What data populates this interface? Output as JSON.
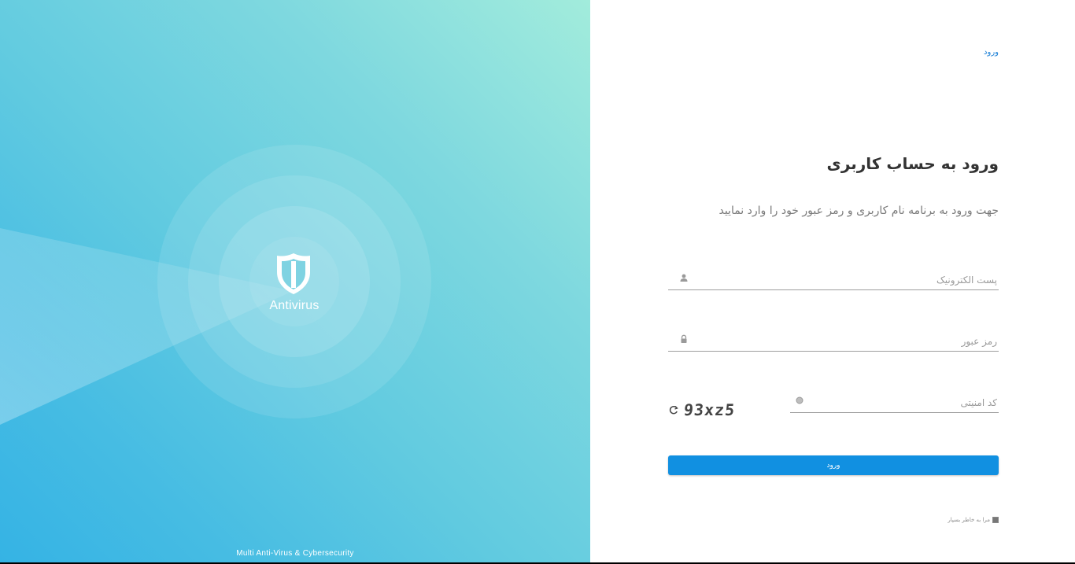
{
  "hero": {
    "logo_text": "Antivirus",
    "footer_text": "Multi Anti-Virus & Cybersecurity"
  },
  "panel": {
    "top_link": "ورود",
    "title": "ورود به حساب کاربری",
    "subtitle": "جهت ورود به برنامه نام کاربری و رمز عبور خود را وارد نمایید",
    "email_placeholder": "پست الکترونیک",
    "email_value": "",
    "password_placeholder": "رمز عبور",
    "password_value": "",
    "captcha_placeholder": "کد امنیتی",
    "captcha_value": "",
    "captcha_code": "93xz5",
    "login_label": "ورود",
    "remember_label": "مرا به خاطر بسپار",
    "remember_checked": true
  },
  "colors": {
    "accent": "#1190e1",
    "link": "#1a7fd6",
    "hero_light": "#a2ecdc",
    "hero_dark": "#35b3e4"
  },
  "icons": {
    "email": "user-icon",
    "password": "lock-icon",
    "captcha": "circle-icon",
    "refresh": "refresh-icon",
    "logo": "shield-icon"
  }
}
